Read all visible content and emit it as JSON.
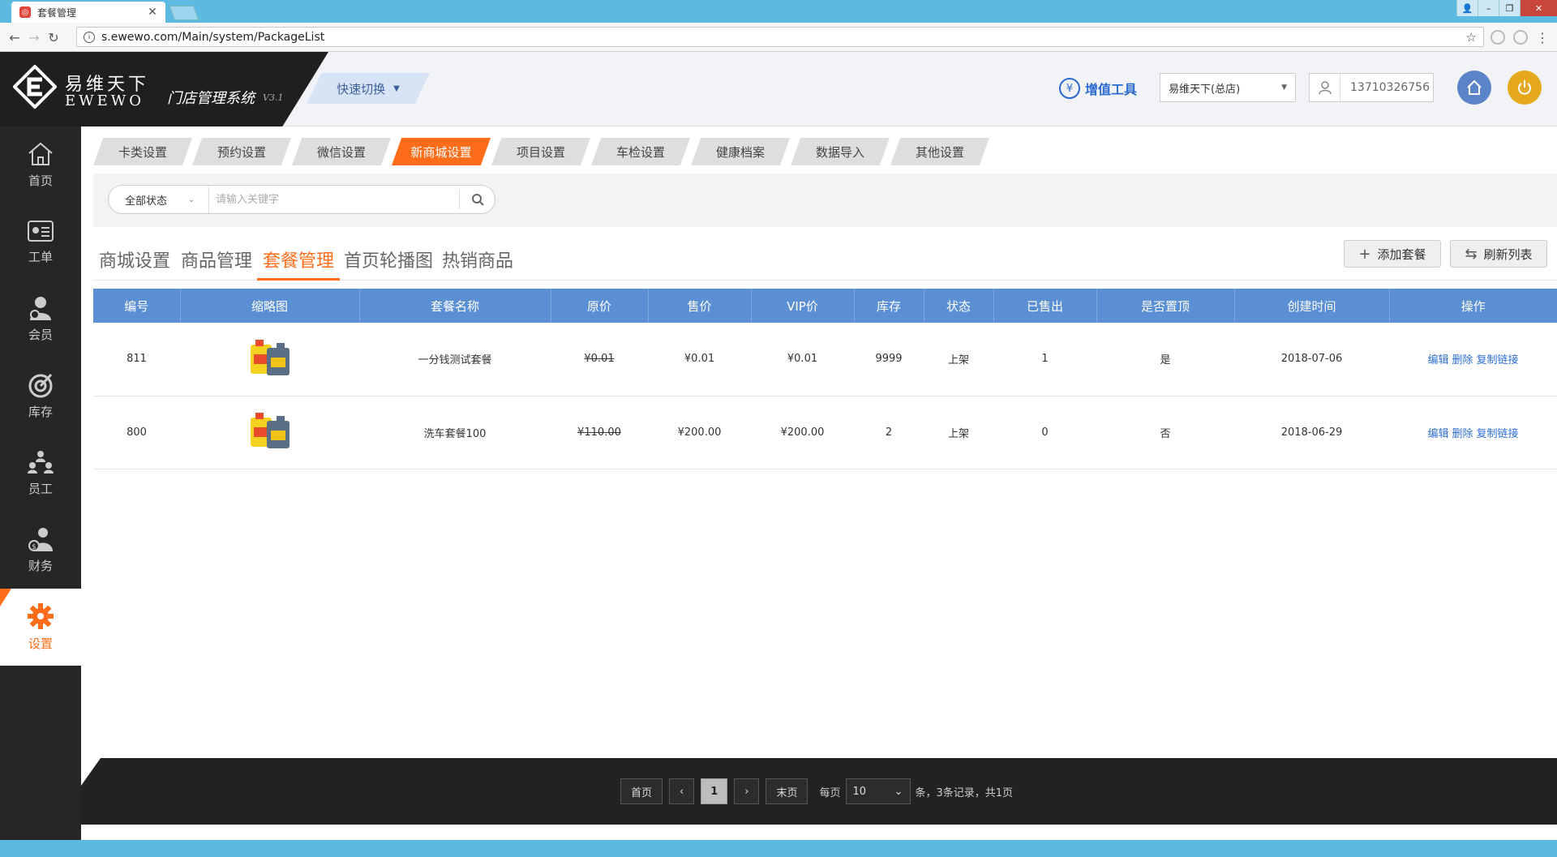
{
  "browser": {
    "tab_title": "套餐管理",
    "url": "s.ewewo.com/Main/system/PackageList"
  },
  "header": {
    "logo_cn": "易维天下",
    "logo_en": "EWEWO",
    "system_name": "门店管理系统",
    "version": "V3.1",
    "quick_switch": "快速切换",
    "vat_tool": "增值工具",
    "store": "易维天下(总店)",
    "user_phone": "13710326756"
  },
  "sidebar": {
    "items": [
      {
        "label": "首页",
        "icon": "home-icon"
      },
      {
        "label": "工单",
        "icon": "work-order-icon"
      },
      {
        "label": "会员",
        "icon": "member-icon"
      },
      {
        "label": "库存",
        "icon": "inventory-icon"
      },
      {
        "label": "员工",
        "icon": "staff-icon"
      },
      {
        "label": "财务",
        "icon": "finance-icon"
      },
      {
        "label": "设置",
        "icon": "gear-icon"
      }
    ],
    "active": "设置"
  },
  "top_tabs": [
    "卡类设置",
    "预约设置",
    "微信设置",
    "新商城设置",
    "项目设置",
    "车检设置",
    "健康档案",
    "数据导入",
    "其他设置"
  ],
  "active_top_tab": "新商城设置",
  "filter": {
    "status": "全部状态",
    "keyword_placeholder": "请输入关键字"
  },
  "sub_tabs": [
    "商城设置",
    "商品管理",
    "套餐管理",
    "首页轮播图",
    "热销商品"
  ],
  "active_sub_tab": "套餐管理",
  "actions": {
    "add": "添加套餐",
    "refresh": "刷新列表"
  },
  "table": {
    "columns": [
      "编号",
      "缩略图",
      "套餐名称",
      "原价",
      "售价",
      "VIP价",
      "库存",
      "状态",
      "已售出",
      "是否置顶",
      "创建时间",
      "操作"
    ],
    "rows": [
      {
        "id": "811",
        "name": "一分钱测试套餐",
        "original_price": "¥0.01",
        "price": "¥0.01",
        "vip_price": "¥0.01",
        "stock": "9999",
        "status": "上架",
        "sold": "1",
        "top": "是",
        "created": "2018-07-06"
      },
      {
        "id": "800",
        "name": "洗车套餐100",
        "original_price": "¥110.00",
        "price": "¥200.00",
        "vip_price": "¥200.00",
        "stock": "2",
        "status": "上架",
        "sold": "0",
        "top": "否",
        "created": "2018-06-29"
      }
    ],
    "ops": {
      "edit": "编辑",
      "delete": "删除",
      "copy": "复制链接"
    }
  },
  "pager": {
    "first": "首页",
    "prev": "‹",
    "current": "1",
    "next": "›",
    "last": "末页",
    "per_page_label": "每页",
    "per_page": "10",
    "summary": "条，3条记录，共1页"
  },
  "colors": {
    "accent": "#ff6d1b",
    "table_header": "#5b8fd4",
    "sidebar_bg": "#262626",
    "link": "#2f6fd3"
  }
}
